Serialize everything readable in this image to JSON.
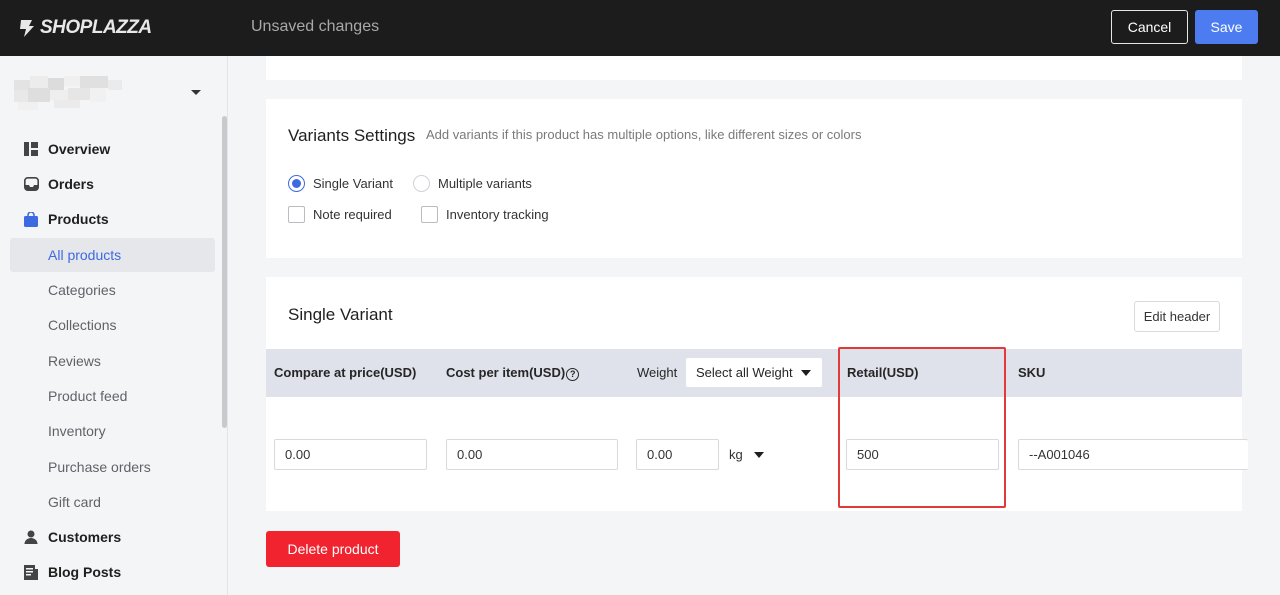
{
  "header": {
    "brand": "SHOPLAZZA",
    "status_text": "Unsaved changes",
    "cancel_label": "Cancel",
    "save_label": "Save"
  },
  "sidebar": {
    "items": [
      {
        "label": "Overview",
        "icon": "overview-icon"
      },
      {
        "label": "Orders",
        "icon": "inbox-icon"
      },
      {
        "label": "Products",
        "icon": "shopping-bag-icon"
      },
      {
        "label": "All products"
      },
      {
        "label": "Categories"
      },
      {
        "label": "Collections"
      },
      {
        "label": "Reviews"
      },
      {
        "label": "Product feed"
      },
      {
        "label": "Inventory"
      },
      {
        "label": "Purchase orders"
      },
      {
        "label": "Gift card"
      },
      {
        "label": "Customers",
        "icon": "person-icon"
      },
      {
        "label": "Blog Posts",
        "icon": "blog-icon"
      }
    ],
    "active_item": "All products"
  },
  "variants_settings": {
    "title": "Variants Settings",
    "description": "Add variants if this product has multiple options, like different sizes or colors",
    "single_variant_label": "Single Variant",
    "multiple_variants_label": "Multiple variants",
    "selected_option": "Single Variant",
    "note_required_label": "Note required",
    "inventory_tracking_label": "Inventory tracking"
  },
  "single_variant": {
    "title": "Single Variant",
    "edit_header_label": "Edit header",
    "columns": {
      "compare_at_price": "Compare at price(USD)",
      "cost_per_item": "Cost per item(USD)",
      "weight": "Weight",
      "weight_select": "Select all Weight",
      "retail": "Retail(USD)",
      "sku": "SKU"
    },
    "row": {
      "compare_at_price": "0.00",
      "cost_per_item": "0.00",
      "weight": "0.00",
      "weight_unit": "kg",
      "retail": "500",
      "sku": "--A001046"
    }
  },
  "delete_label": "Delete product",
  "colors": {
    "accent": "#4c7cf0",
    "danger": "#f0232f",
    "highlight": "#e03b3b",
    "topbar": "#1c1c1c"
  }
}
